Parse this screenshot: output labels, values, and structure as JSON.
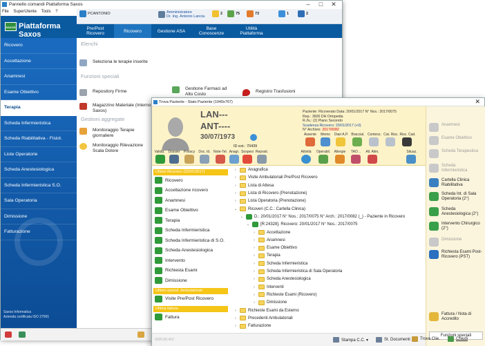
{
  "main_window": {
    "title": "Pannello comandi Piattaforma Saxos",
    "menu": [
      "File",
      "SuperUtente",
      "Tools",
      "?"
    ],
    "strip": {
      "user_label": "PCANTONIO",
      "admin_line1": "Amministratore",
      "admin_line2": "Dr. Ing. Antonio Lancia",
      "badges": [
        "2",
        "75",
        "73",
        "1",
        "2"
      ]
    },
    "brand": "Piattaforma Saxos",
    "brand_logo_text": "SAXOS",
    "topnav": [
      "Pre/Post\nRicovero",
      "Ricovero",
      "Gestione ASA",
      "Base\nConoscenze",
      "Utilità\nPiattaforma"
    ],
    "sidebar": [
      "Ricovero",
      "Accettazione",
      "Anamnesi",
      "Esame Obiettivo",
      "Terapia",
      "Scheda Infermieristica",
      "Scheda Riabilitativa - Fisiot.",
      "Liste Operatorie",
      "Scheda Anestesiologica",
      "Scheda Infermieristica S.O.",
      "Sala Operatoria",
      "Dimissione",
      "Fatturazione"
    ],
    "sidebar_footer": [
      "Saxos Informatica",
      "Azienda certificata ISO 27001"
    ],
    "content": {
      "section_elenchi": "Elenchi",
      "item_terapie": "Seleziona le terapie inserite",
      "section_speciali": "Funzioni speciali",
      "item_repository": "Repository Firme",
      "item_farmaci": "Gestione Farmaci ad Alto Costo",
      "item_trasfusioni": "Registro Trasfusioni",
      "item_magazzino": "Magazzino Materiale (Interno Saxos)",
      "section_aggregate": "Gestioni aggregate",
      "item_monitor_terapie": "Monitoraggio Terapie giornaliere",
      "item_monitor_dolore": "Monitoraggio Rilevazione Scala Dolore"
    }
  },
  "patient_window": {
    "title": "Trova Paziente - Stato Paziente (1040x767)",
    "name_line1": "LAN---",
    "name_line2": "ANT----",
    "birth_date": "30/07/1973",
    "id_est": "ID est.: 70439",
    "info": {
      "line1": "Paziente: Ricoverato  Data: 20/01/2017   N° Nos.: 2017/0075",
      "line2": "Rep.: 3600    DH    Ortopedia",
      "line3": "R./Is.: (2) Piano Secondo",
      "line4": "Scadenza Ricovero: 20/01/2017 (+0)",
      "line5_label": "N° Archivio: ",
      "line5_value": "2017/0082"
    },
    "flags": [
      "Assente",
      "Memo",
      "Diari A.P.",
      "Braccial.",
      "Contenz.",
      "Cat. Risc.",
      "Risc. Cad."
    ],
    "actions_left": [
      "Valida.",
      "Dossier",
      "Privacy",
      "Doc. Id.",
      "Note-Tel.",
      "Anagr."
    ],
    "actions_mid": [
      "Sospesi",
      "Reposit."
    ],
    "actions_right": [
      "Attività",
      "Operabil.",
      "Allergie",
      "TAO ..",
      "All. Alim.",
      "Situaz."
    ],
    "left_list": {
      "head1": "Ultimo Ricovero (20/01/2017)",
      "items": [
        "Ricovero",
        "Accettazione ricovero",
        "Anamnesi",
        "Esame Obiettivo",
        "Terapia",
        "Scheda Infermieristica",
        "Scheda Infermieristica di S.O.",
        "Scheda Anestesiologica",
        "Intervento",
        "Richiesta Esami",
        "Dimissione"
      ],
      "head2": "Ultimo episod. Ambulatoriali",
      "items2": [
        "Visite Pre/Post Ricovero"
      ],
      "head3": "Ultima fattura",
      "items3": [
        "Fattura"
      ]
    },
    "tree": [
      {
        "t": "Anagrafica",
        "lvl": 0,
        "k": "folder"
      },
      {
        "t": "Visite Ambulatoriali Pre/Post Ricovero",
        "lvl": 0,
        "k": "folder"
      },
      {
        "t": "Lista di Attesa",
        "lvl": 0,
        "k": "folder"
      },
      {
        "t": "Lista di Ricovero (Prenotazione)",
        "lvl": 0,
        "k": "folder"
      },
      {
        "t": "Lista Operatoria (Prenotazione)",
        "lvl": 0,
        "k": "folder"
      },
      {
        "t": "Ricoveri (C.C.: Cartella Clinica)",
        "lvl": 0,
        "k": "folder"
      },
      {
        "t": "D.: 20/01/2017 N° Nos.: 2017/0075 N° Arch.: 2017/0082 (_) - Paziente in Ricovero",
        "lvl": 1,
        "k": "green"
      },
      {
        "t": "[R:24328]. Ricovero: 20/01/2017 N° Nos.: 2017/0075",
        "lvl": 2,
        "k": "green"
      },
      {
        "t": "Accettazione",
        "lvl": 3,
        "k": "folder"
      },
      {
        "t": "Anamnesi",
        "lvl": 3,
        "k": "folder"
      },
      {
        "t": "Esame Obiettivo",
        "lvl": 3,
        "k": "folder"
      },
      {
        "t": "Terapia",
        "lvl": 3,
        "k": "folder"
      },
      {
        "t": "Scheda Infermieristica",
        "lvl": 3,
        "k": "folder"
      },
      {
        "t": "Scheda Infermieristica di Sala Operatoria",
        "lvl": 3,
        "k": "folder"
      },
      {
        "t": "Scheda Anestesiologica",
        "lvl": 3,
        "k": "folder"
      },
      {
        "t": "Interventi",
        "lvl": 3,
        "k": "folder"
      },
      {
        "t": "Richieste Esami (Ricovero)",
        "lvl": 3,
        "k": "folder"
      },
      {
        "t": "Dimissione",
        "lvl": 3,
        "k": "folder"
      },
      {
        "t": "Richieste Esami da Esterno",
        "lvl": 0,
        "k": "folder"
      },
      {
        "t": "Precedenti Ambulatoriali",
        "lvl": 0,
        "k": "folder"
      },
      {
        "t": "Fatturazione",
        "lvl": 0,
        "k": "folder"
      }
    ],
    "right_panel": {
      "anamnesi": "Anamnesi",
      "esame": "Esame Obiettivo",
      "scheda_terapeutica": "Scheda Terapeutica",
      "scheda_infermieristica": "Scheda Infermieristica",
      "cartella": "Cartella Clinica Riabilitativa",
      "scheda_int": "Scheda Int. di Sala Operatoria (2°)",
      "scheda_anest": "Scheda Anestesiologica (2°)",
      "intervento": "Intervento Chirurgico (2°)",
      "dimissione": "Dimissione",
      "richiesta": "Richiesta Esami Post-Ricovero (PST)",
      "fattura": "Fattura / Nota di Accredito",
      "funzioni": "Funzioni speciali"
    },
    "bottom": {
      "code": "0020.00.410",
      "stampa": "Stampa C.C. ▾",
      "documenti": "St. Documenti",
      "trova": "Trova Clie.",
      "chiudi": "Chiudi"
    }
  },
  "colors": {
    "brand_blue": "#0a5aa0",
    "patient_yellow": "#fdf3c8",
    "alert_red": "#d00000"
  }
}
